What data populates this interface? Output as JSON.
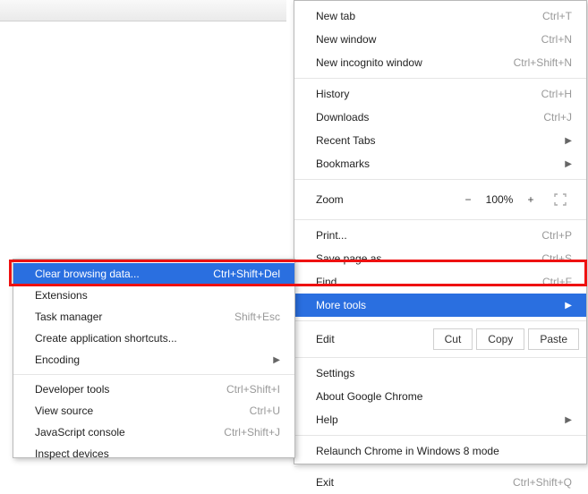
{
  "main_menu": {
    "new_tab": {
      "label": "New tab",
      "shortcut": "Ctrl+T"
    },
    "new_window": {
      "label": "New window",
      "shortcut": "Ctrl+N"
    },
    "new_incognito": {
      "label": "New incognito window",
      "shortcut": "Ctrl+Shift+N"
    },
    "history": {
      "label": "History",
      "shortcut": "Ctrl+H"
    },
    "downloads": {
      "label": "Downloads",
      "shortcut": "Ctrl+J"
    },
    "recent_tabs": {
      "label": "Recent Tabs"
    },
    "bookmarks": {
      "label": "Bookmarks"
    },
    "zoom": {
      "label": "Zoom",
      "minus": "−",
      "value": "100%",
      "plus": "+"
    },
    "print": {
      "label": "Print...",
      "shortcut": "Ctrl+P"
    },
    "save_as": {
      "label": "Save page as...",
      "shortcut": "Ctrl+S"
    },
    "find": {
      "label": "Find...",
      "shortcut": "Ctrl+F"
    },
    "more_tools": {
      "label": "More tools"
    },
    "edit": {
      "label": "Edit",
      "cut": "Cut",
      "copy": "Copy",
      "paste": "Paste"
    },
    "settings": {
      "label": "Settings"
    },
    "about": {
      "label": "About Google Chrome"
    },
    "help": {
      "label": "Help"
    },
    "relaunch": {
      "label": "Relaunch Chrome in Windows 8 mode"
    },
    "exit": {
      "label": "Exit",
      "shortcut": "Ctrl+Shift+Q"
    }
  },
  "sub_menu": {
    "clear_data": {
      "label": "Clear browsing data...",
      "shortcut": "Ctrl+Shift+Del"
    },
    "extensions": {
      "label": "Extensions"
    },
    "task_manager": {
      "label": "Task manager",
      "shortcut": "Shift+Esc"
    },
    "create_shortcuts": {
      "label": "Create application shortcuts..."
    },
    "encoding": {
      "label": "Encoding"
    },
    "dev_tools": {
      "label": "Developer tools",
      "shortcut": "Ctrl+Shift+I"
    },
    "view_source": {
      "label": "View source",
      "shortcut": "Ctrl+U"
    },
    "js_console": {
      "label": "JavaScript console",
      "shortcut": "Ctrl+Shift+J"
    },
    "inspect_devices": {
      "label": "Inspect devices"
    }
  }
}
